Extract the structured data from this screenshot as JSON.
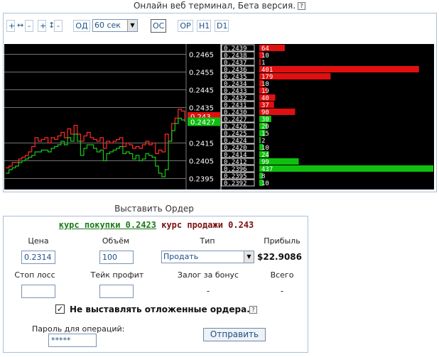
{
  "page": {
    "title": "Онлайн веб терминал, Бета версия.",
    "help_glyph": "?"
  },
  "toolbar": {
    "zoom_h_plus": "+",
    "zoom_h_icon": "↔",
    "zoom_h_minus": "-",
    "zoom_v_plus": "+",
    "zoom_v_icon": "↕",
    "zoom_v_minus": "-",
    "od": "ОД",
    "interval": "60 сек",
    "oc": "ОС",
    "op": "ОР",
    "h1": "Н1",
    "d1": "D1"
  },
  "chart_data": {
    "type": "line",
    "ylim": [
      0.239,
      0.247
    ],
    "y_ticks": [
      "0.2465",
      "0.2455",
      "0.2445",
      "0.2435",
      "0.2415",
      "0.2405",
      "0.2395"
    ],
    "series": [
      {
        "color": "#ff2a2a",
        "values": [
          0.2401,
          0.2402,
          0.2404,
          0.2404,
          0.2406,
          0.2407,
          0.2408,
          0.241,
          0.2413,
          0.2418,
          0.2416,
          0.2417,
          0.2418,
          0.2415,
          0.2418,
          0.2417,
          0.2419,
          0.2421,
          0.2418,
          0.2423,
          0.242,
          0.2425,
          0.242,
          0.2416,
          0.2419,
          0.2421,
          0.2418,
          0.2417,
          0.2416,
          0.2418,
          0.2412,
          0.2416,
          0.2415,
          0.2416,
          0.2417,
          0.2418,
          0.2413,
          0.2415,
          0.2414,
          0.2412,
          0.2413,
          0.2412,
          0.2414,
          0.2416,
          0.2414,
          0.2415,
          0.2409,
          0.2411,
          0.241,
          0.242,
          0.2416,
          0.2426,
          0.2429,
          0.2434,
          0.2433,
          0.2427
        ]
      },
      {
        "color": "#19c619",
        "values": [
          0.2398,
          0.24,
          0.2401,
          0.2402,
          0.2404,
          0.2405,
          0.2406,
          0.2407,
          0.2408,
          0.241,
          0.241,
          0.2411,
          0.2411,
          0.241,
          0.2412,
          0.2413,
          0.2414,
          0.2416,
          0.2414,
          0.2418,
          0.2416,
          0.242,
          0.2416,
          0.2408,
          0.2412,
          0.2414,
          0.2414,
          0.2412,
          0.241,
          0.2411,
          0.2405,
          0.2409,
          0.241,
          0.2411,
          0.2412,
          0.2413,
          0.2409,
          0.241,
          0.2409,
          0.2406,
          0.2408,
          0.2405,
          0.2406,
          0.2409,
          0.2408,
          0.2407,
          0.2402,
          0.2398,
          0.2396,
          0.24,
          0.2416,
          0.2422,
          0.2426,
          0.2429,
          0.2428,
          0.2427
        ]
      }
    ],
    "current_sell": "0.243",
    "current_buy": "0.2427",
    "order_book": [
      {
        "price": "0.2439",
        "volume": "64",
        "side": "sell"
      },
      {
        "price": "0.2438",
        "volume": "10",
        "side": "sell"
      },
      {
        "price": "0.2437",
        "volume": "1",
        "side": "sell"
      },
      {
        "price": "0.2436",
        "volume": "401",
        "side": "sell"
      },
      {
        "price": "0.2435",
        "volume": "179",
        "side": "sell"
      },
      {
        "price": "0.2434",
        "volume": "10",
        "side": "sell"
      },
      {
        "price": "0.2433",
        "volume": "19",
        "side": "sell"
      },
      {
        "price": "0.2432",
        "volume": "40",
        "side": "sell"
      },
      {
        "price": "0.2431",
        "volume": "37",
        "side": "sell"
      },
      {
        "price": "0.2430",
        "volume": "90",
        "side": "sell"
      },
      {
        "price": "0.2427",
        "volume": "30",
        "side": "buy"
      },
      {
        "price": "0.2426",
        "volume": "20",
        "side": "buy"
      },
      {
        "price": "0.2425",
        "volume": "15",
        "side": "buy"
      },
      {
        "price": "0.2424",
        "volume": "2",
        "side": "buy"
      },
      {
        "price": "0.2420",
        "volume": "10",
        "side": "buy"
      },
      {
        "price": "0.2414",
        "volume": "24",
        "side": "buy"
      },
      {
        "price": "0.2412",
        "volume": "99",
        "side": "buy"
      },
      {
        "price": "0.2396",
        "volume": "437",
        "side": "buy"
      },
      {
        "price": "0.2395",
        "volume": "8",
        "side": "buy"
      },
      {
        "price": "0.2392",
        "volume": "10",
        "side": "buy"
      }
    ],
    "colors": {
      "sell": "#e01010",
      "buy": "#0fbf0f",
      "grid": "#9a9a9a"
    }
  },
  "order": {
    "heading": "Выставить Ордер",
    "buy_rate_label": "курс покупки 0.2423",
    "sell_rate_label": "курс продажи 0.243",
    "price_label": "Цена",
    "price_value": "0.2314",
    "volume_label": "Объём",
    "volume_value": "100",
    "type_label": "Тип",
    "type_value": "Продать",
    "profit_label": "Прибыль",
    "profit_value": "$22.9086",
    "stop_loss_label": "Стоп лосс",
    "stop_loss_value": "",
    "take_profit_label": "Тейк профит",
    "take_profit_value": "",
    "bonus_label": "Залог за бонус",
    "bonus_value": "-",
    "total_label": "Всего",
    "total_value": "-",
    "no_pending_label": "Не выставлять отложенные ордера.",
    "checkbox_glyph": "✓",
    "password_label": "Пароль для операций:",
    "password_value": "*****",
    "submit_label": "Отправить"
  }
}
